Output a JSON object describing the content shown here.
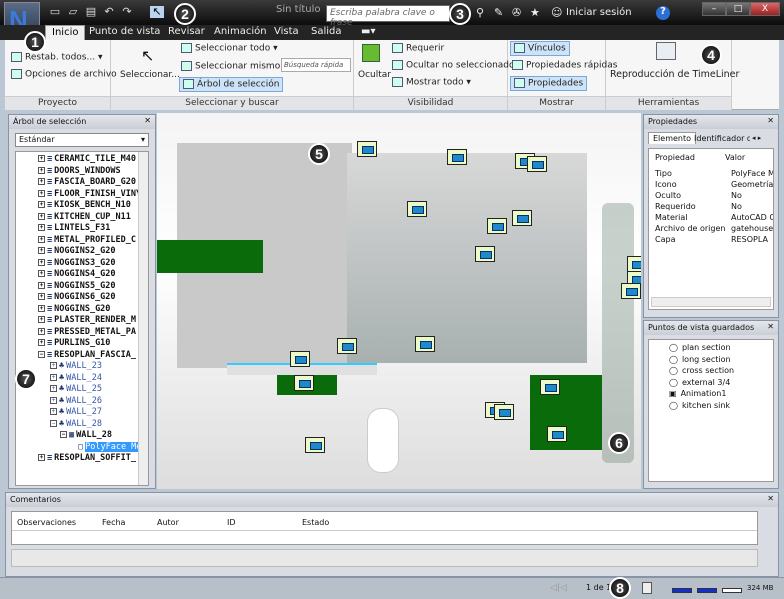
{
  "titlebar": {
    "app_logo": "N",
    "title": "Sin título",
    "search_placeholder": "Escriba palabra clave o frase",
    "login": "Iniciar sesión",
    "help": "?",
    "minimize": "–",
    "maximize": "□",
    "close": "X"
  },
  "quick_access": [
    "new-icon",
    "open-icon",
    "print-icon",
    "undo-icon",
    "redo-icon",
    "select-icon"
  ],
  "tabs": [
    "Inicio",
    "Punto de vista",
    "Revisar",
    "Animación",
    "Vista",
    "Salida"
  ],
  "active_tab": "Inicio",
  "ribbon": {
    "proyecto": {
      "label": "Proyecto",
      "restab": "Restab. todos...",
      "opciones": "Opciones de archivo"
    },
    "seleccionar": {
      "label": "Seleccionar y buscar",
      "seleccionar": "Seleccionar...",
      "todo": "Seleccionar todo",
      "mismo": "Seleccionar mismo",
      "arbol": "Árbol de selección",
      "busqueda_placeholder": "Búsqueda rápida"
    },
    "visibilidad": {
      "label": "Visibilidad",
      "ocultar": "Ocultar",
      "requerir": "Requerir",
      "ocultar_no": "Ocultar no seleccionados",
      "mostrar": "Mostrar todo"
    },
    "mostrar": {
      "label": "Mostrar",
      "vinculos": "Vínculos",
      "rapidas": "Propiedades rápidas",
      "propiedades": "Propiedades"
    },
    "herramientas": {
      "label": "Herramientas",
      "timeliner": "Reproducción de TimeLiner"
    }
  },
  "selection_tree": {
    "title": "Árbol de selección",
    "mode": "Estándar",
    "items": [
      "CERAMIC_TILE_M40",
      "DOORS_WINDOWS",
      "FASCIA_BOARD_G20",
      "FLOOR_FINISH_VINY",
      "KIOSK_BENCH_N10",
      "KITCHEN_CUP_N11",
      "LINTELS_F31",
      "METAL_PROFILED_C",
      "NOGGINS2_G20",
      "NOGGINS3_G20",
      "NOGGINS4_G20",
      "NOGGINS5_G20",
      "NOGGINS6_G20",
      "NOGGINS_G20",
      "PLASTER_RENDER_M",
      "PRESSED_METAL_PA",
      "PURLINS_G10",
      "RESOPLAN_FASCIA_"
    ],
    "children": [
      "WALL_23",
      "WALL_24",
      "WALL_25",
      "WALL_26",
      "WALL_27",
      "WALL_28"
    ],
    "sub": "WALL_28",
    "selected": "PolyFace Mesh",
    "after": "RESOPLAN_SOFFIT_"
  },
  "properties": {
    "title": "Propiedades",
    "tabs": [
      "Elemento",
      "Identificador d"
    ],
    "col_prop": "Propiedad",
    "col_val": "Valor",
    "rows": [
      [
        "Tipo",
        "PolyFace M"
      ],
      [
        "Icono",
        "Geometría"
      ],
      [
        "Oculto",
        "No"
      ],
      [
        "Requerido",
        "No"
      ],
      [
        "Material",
        "AutoCAD C"
      ],
      [
        "Archivo de origen",
        "gatehouse_"
      ],
      [
        "Capa",
        "RESOPLA"
      ]
    ]
  },
  "viewpoints": {
    "title": "Puntos de vista guardados",
    "items": [
      "plan section",
      "long section",
      "cross section",
      "external 3/4",
      "Animation1",
      "kitchen sink"
    ]
  },
  "comments": {
    "title": "Comentarios",
    "columns": [
      "Observaciones",
      "Fecha",
      "Autor",
      "ID",
      "Estado"
    ]
  },
  "status": {
    "page": "1 de 1",
    "memory": "324 MB"
  },
  "callouts": [
    "1",
    "2",
    "3",
    "4",
    "5",
    "6",
    "7",
    "8"
  ]
}
